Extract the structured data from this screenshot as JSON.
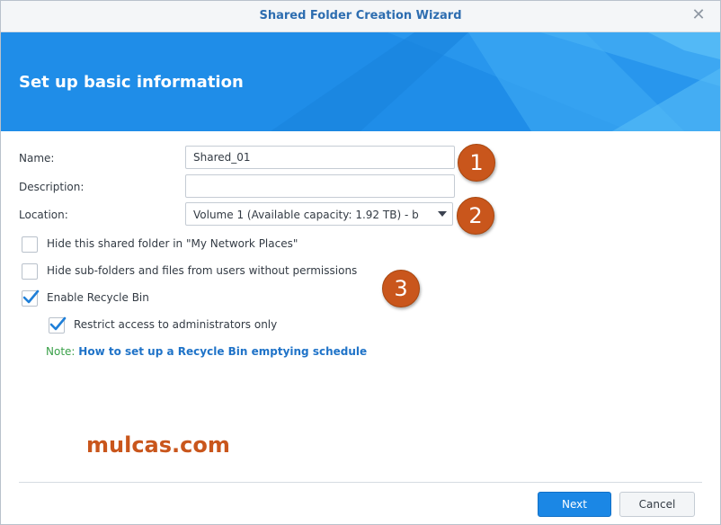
{
  "window": {
    "title": "Shared Folder Creation Wizard",
    "close_symbol": "✕"
  },
  "banner": {
    "heading": "Set up basic information"
  },
  "form": {
    "name_label": "Name:",
    "name_value": "Shared_01",
    "description_label": "Description:",
    "description_value": "",
    "location_label": "Location:",
    "location_value": "Volume 1 (Available capacity:  1.92 TB) - b"
  },
  "options": [
    {
      "label": "Hide this shared folder in \"My Network Places\"",
      "checked": false
    },
    {
      "label": "Hide sub-folders and files from users without permissions",
      "checked": false
    },
    {
      "label": "Enable Recycle Bin",
      "checked": true
    },
    {
      "label": "Restrict access to administrators only",
      "checked": true
    }
  ],
  "note": {
    "label": "Note:",
    "link": "How to set up a Recycle Bin emptying schedule"
  },
  "annotations": [
    "1",
    "2",
    "3"
  ],
  "watermark": "mulcas.com",
  "buttons": {
    "next": "Next",
    "cancel": "Cancel"
  },
  "colors": {
    "accent": "#1f8de8",
    "badge": "#c9561c",
    "link": "#1f73c8",
    "note": "#3ba14a"
  }
}
